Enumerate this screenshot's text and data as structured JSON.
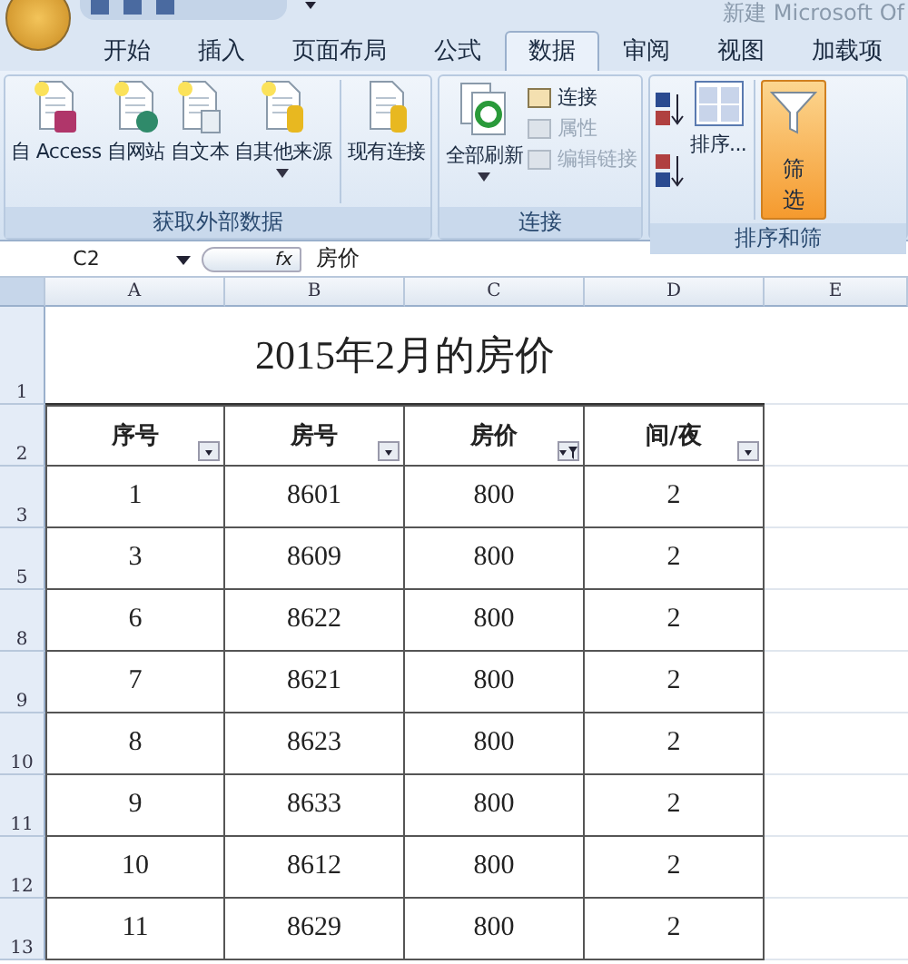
{
  "window": {
    "title": "新建 Microsoft Of"
  },
  "tabs": [
    {
      "label": "开始",
      "selected": false
    },
    {
      "label": "插入",
      "selected": false
    },
    {
      "label": "页面布局",
      "selected": false
    },
    {
      "label": "公式",
      "selected": false
    },
    {
      "label": "数据",
      "selected": true
    },
    {
      "label": "审阅",
      "selected": false
    },
    {
      "label": "视图",
      "selected": false
    },
    {
      "label": "加载项",
      "selected": false
    }
  ],
  "ribbon": {
    "external_data": {
      "label": "获取外部数据",
      "buttons": [
        {
          "label": "自 Access",
          "dropdown": false
        },
        {
          "label": "自网站",
          "dropdown": false
        },
        {
          "label": "自文本",
          "dropdown": false
        },
        {
          "label": "自其他来源",
          "dropdown": true
        },
        {
          "label": "现有连接",
          "dropdown": false
        }
      ]
    },
    "connections": {
      "label": "连接",
      "refresh_all": {
        "label": "全部刷新",
        "dropdown": true
      },
      "items": [
        {
          "label": "连接",
          "disabled": false
        },
        {
          "label": "属性",
          "disabled": true
        },
        {
          "label": "编辑链接",
          "disabled": true
        }
      ]
    },
    "sort_filter": {
      "label": "排序和筛",
      "sort_button": "排序...",
      "filter_button": {
        "label": "筛选",
        "selected": true
      }
    }
  },
  "formula_bar": {
    "name_box": "C2",
    "function_label": "fx",
    "formula": "房价"
  },
  "sheet": {
    "columns": [
      "A",
      "B",
      "C",
      "D",
      "E"
    ],
    "title_row": {
      "number": "1",
      "title": "2015年2月的房价"
    },
    "header_row": {
      "number": "2",
      "headers": [
        {
          "label": "序号",
          "filtered": false
        },
        {
          "label": "房号",
          "filtered": false
        },
        {
          "label": "房价",
          "filtered": true
        },
        {
          "label": "间/夜",
          "filtered": false
        }
      ]
    },
    "rows": [
      {
        "number": "3",
        "cells": [
          "1",
          "8601",
          "800",
          "2"
        ]
      },
      {
        "number": "5",
        "cells": [
          "3",
          "8609",
          "800",
          "2"
        ]
      },
      {
        "number": "8",
        "cells": [
          "6",
          "8622",
          "800",
          "2"
        ]
      },
      {
        "number": "9",
        "cells": [
          "7",
          "8621",
          "800",
          "2"
        ]
      },
      {
        "number": "10",
        "cells": [
          "8",
          "8623",
          "800",
          "2"
        ]
      },
      {
        "number": "11",
        "cells": [
          "9",
          "8633",
          "800",
          "2"
        ]
      },
      {
        "number": "12",
        "cells": [
          "10",
          "8612",
          "800",
          "2"
        ]
      },
      {
        "number": "13",
        "cells": [
          "11",
          "8629",
          "800",
          "2"
        ]
      }
    ]
  }
}
